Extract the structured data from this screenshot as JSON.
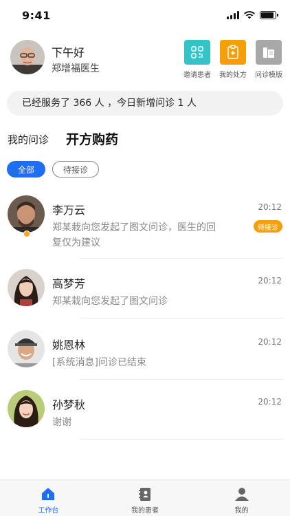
{
  "status_bar": {
    "time": "9:41",
    "battery_level": 0.9
  },
  "header": {
    "greeting": "下午好",
    "doctor_name": "郑增福医生",
    "actions": [
      {
        "label": "邀请患者",
        "icon": "qr-code-icon",
        "color": "#35c3c7"
      },
      {
        "label": "我的处方",
        "icon": "prescription-icon",
        "color": "#f5a00b"
      },
      {
        "label": "问诊模版",
        "icon": "template-icon",
        "color": "#a8a8a8"
      }
    ]
  },
  "summary": {
    "text": "已经服务了 366 人 ，今日新增问诊 1 人"
  },
  "tabs": {
    "my_consult": "我的问诊",
    "prescribe": "开方购药"
  },
  "filters": {
    "all": "全部",
    "pending": "待接诊"
  },
  "conversations": [
    {
      "name": "李万云",
      "time": "20:12",
      "message": "郑某栽向您发起了图文问诊，医生的回复仅为建议",
      "badge": "待接诊",
      "unread_dot": true
    },
    {
      "name": "高梦芳",
      "time": "20:12",
      "message": "郑某栽向您发起了图文问诊"
    },
    {
      "name": "姚恩林",
      "time": "20:12",
      "message": "[系统消息]问诊已结束"
    },
    {
      "name": "孙梦秋",
      "time": "20:12",
      "message": "谢谢"
    }
  ],
  "bottom_nav": [
    {
      "label": "工作台",
      "icon": "home-icon",
      "active": true
    },
    {
      "label": "我的患者",
      "icon": "contacts-book-icon",
      "active": false
    },
    {
      "label": "我的",
      "icon": "user-icon",
      "active": false
    }
  ],
  "colors": {
    "primary": "#1d6ef2",
    "badge": "#f5a00b",
    "teal": "#35c3c7",
    "gray": "#a8a8a8"
  }
}
